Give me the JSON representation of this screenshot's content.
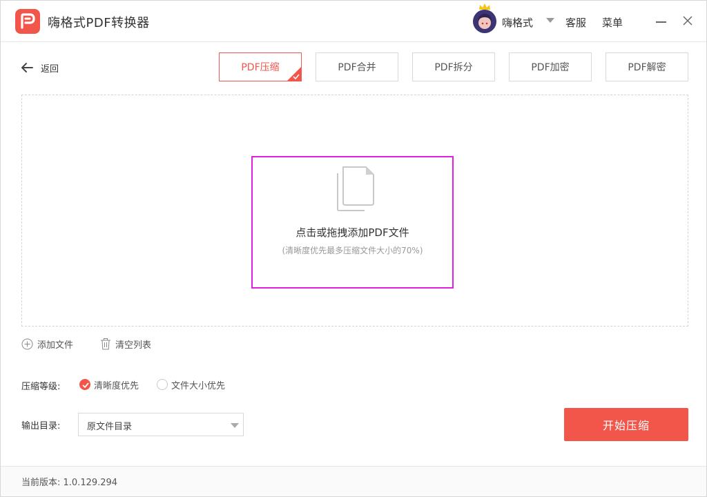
{
  "app": {
    "title": "嗨格式PDF转换器",
    "accent_color": "#f2554a"
  },
  "header": {
    "username": "嗨格式",
    "service_label": "客服",
    "menu_label": "菜单"
  },
  "nav": {
    "back_label": "返回"
  },
  "tabs": [
    {
      "label": "PDF压缩",
      "active": true
    },
    {
      "label": "PDF合并",
      "active": false
    },
    {
      "label": "PDF拆分",
      "active": false
    },
    {
      "label": "PDF加密",
      "active": false
    },
    {
      "label": "PDF解密",
      "active": false
    }
  ],
  "dropzone": {
    "title": "点击或拖拽添加PDF文件",
    "hint": "(清晰度优先最多压缩文件大小的70%)"
  },
  "list_actions": {
    "add_file": "添加文件",
    "clear_list": "清空列表"
  },
  "compression": {
    "label": "压缩等级:",
    "options": [
      {
        "label": "清晰度优先",
        "checked": true
      },
      {
        "label": "文件大小优先",
        "checked": false
      }
    ]
  },
  "output": {
    "label": "输出目录:",
    "selected": "原文件目录"
  },
  "start_button": "开始压缩",
  "footer": {
    "version": "当前版本: 1.0.129.294"
  }
}
